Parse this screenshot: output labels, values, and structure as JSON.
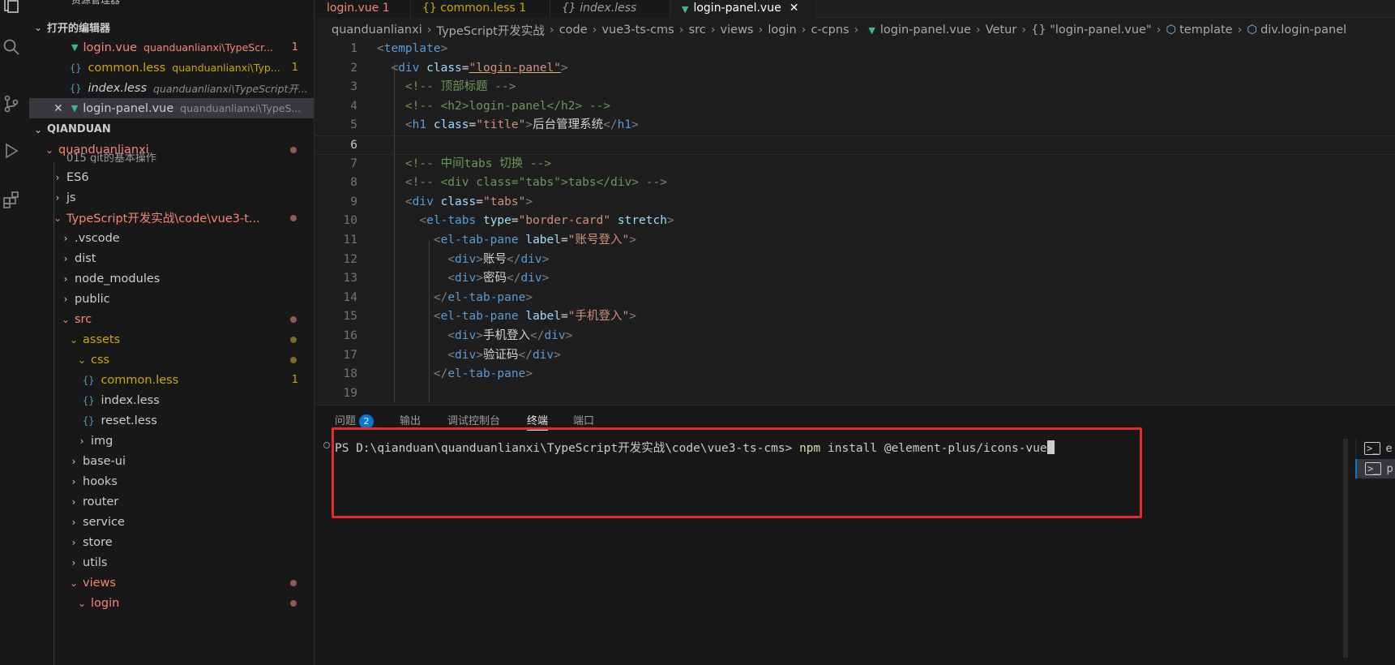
{
  "sidebar": {
    "title": "资源管理器",
    "more": "···",
    "open_editors_header": "打开的编辑器",
    "open_editors": [
      {
        "name": "login.vue",
        "path": "quanduanlianxi\\TypeScr...",
        "badge": "1",
        "icon": "vue-icon"
      },
      {
        "name": "common.less",
        "path": "quanduanlianxi\\Typ...",
        "badge": "1",
        "icon": "braces-icon"
      },
      {
        "name": "index.less",
        "path": "quanduanlianxi\\TypeScript开...",
        "badge": "",
        "icon": "braces-icon"
      },
      {
        "name": "login-panel.vue",
        "path": "quanduanlianxi\\TypeS...",
        "badge": "",
        "icon": "vue-icon"
      }
    ],
    "workspace_header": "QIANDUAN",
    "tree": [
      {
        "label": "quanduanlianxi"
      },
      {
        "label": "015 git的基本操作"
      },
      {
        "label": "ES6"
      },
      {
        "label": "js"
      },
      {
        "label": "TypeScript开发实战\\code\\vue3-t..."
      },
      {
        "label": ".vscode"
      },
      {
        "label": "dist"
      },
      {
        "label": "node_modules"
      },
      {
        "label": "public"
      },
      {
        "label": "src"
      },
      {
        "label": "assets"
      },
      {
        "label": "css"
      },
      {
        "label": "common.less",
        "badge": "1"
      },
      {
        "label": "index.less"
      },
      {
        "label": "reset.less"
      },
      {
        "label": "img"
      },
      {
        "label": "base-ui"
      },
      {
        "label": "hooks"
      },
      {
        "label": "router"
      },
      {
        "label": "service"
      },
      {
        "label": "store"
      },
      {
        "label": "utils"
      },
      {
        "label": "views"
      },
      {
        "label": "login"
      }
    ]
  },
  "tabs": [
    {
      "label": "login.vue 1"
    },
    {
      "label": "{} common.less 1"
    },
    {
      "label": "{} index.less"
    },
    {
      "label": "login-panel.vue"
    }
  ],
  "breadcrumb": [
    "quanduanlianxi",
    "TypeScript开发实战",
    "code",
    "vue3-ts-cms",
    "src",
    "views",
    "login",
    "c-cpns",
    "login-panel.vue",
    "Vetur",
    "{} \"login-panel.vue\"",
    "template",
    "div.login-panel"
  ],
  "code": {
    "line_numbers": [
      "1",
      "2",
      "3",
      "4",
      "5",
      "6",
      "7",
      "8",
      "9",
      "10",
      "11",
      "12",
      "13",
      "14",
      "15",
      "16",
      "17",
      "18",
      "19"
    ],
    "t_template": "template",
    "t_div": "div",
    "t_h1": "h1",
    "t_eltabs": "el-tabs",
    "t_eltabpane": "el-tab-pane",
    "a_class": "class",
    "a_type": "type",
    "a_stretch": "stretch",
    "a_label": "label",
    "s_login_panel": "\"login-panel\"",
    "s_title": "\"title\"",
    "s_tabs": "\"tabs\"",
    "s_border_card": "\"border-card\"",
    "s_account_login": "\"账号登入\"",
    "s_phone_login": "\"手机登入\"",
    "c3": "<!-- 顶部标题 -->",
    "c4": "<!-- <h2>login-panel</h2> -->",
    "c7": "<!-- 中间tabs 切换 -->",
    "c8": "<!-- <div class=\"tabs\">tabs</div> -->",
    "txt_title": "后台管理系统",
    "txt_account": "账号",
    "txt_password": "密码",
    "txt_phone": "手机登入",
    "txt_code": "验证码"
  },
  "panel": {
    "tabs": [
      {
        "label": "问题",
        "badge": "2"
      },
      {
        "label": "输出"
      },
      {
        "label": "调试控制台"
      },
      {
        "label": "终端"
      },
      {
        "label": "端口"
      }
    ],
    "prompt": "PS D:\\qianduan\\quanduanlianxi\\TypeScript开发实战\\code\\vue3-ts-cms>",
    "cmd": "npm",
    "args": "install @element-plus/icons-vue",
    "terminals": [
      {
        "label": "e"
      },
      {
        "label": "p"
      }
    ]
  },
  "colors": {
    "accent_highlight": "#e8282b",
    "badge": "#0078d4",
    "vue": "#41b883"
  }
}
